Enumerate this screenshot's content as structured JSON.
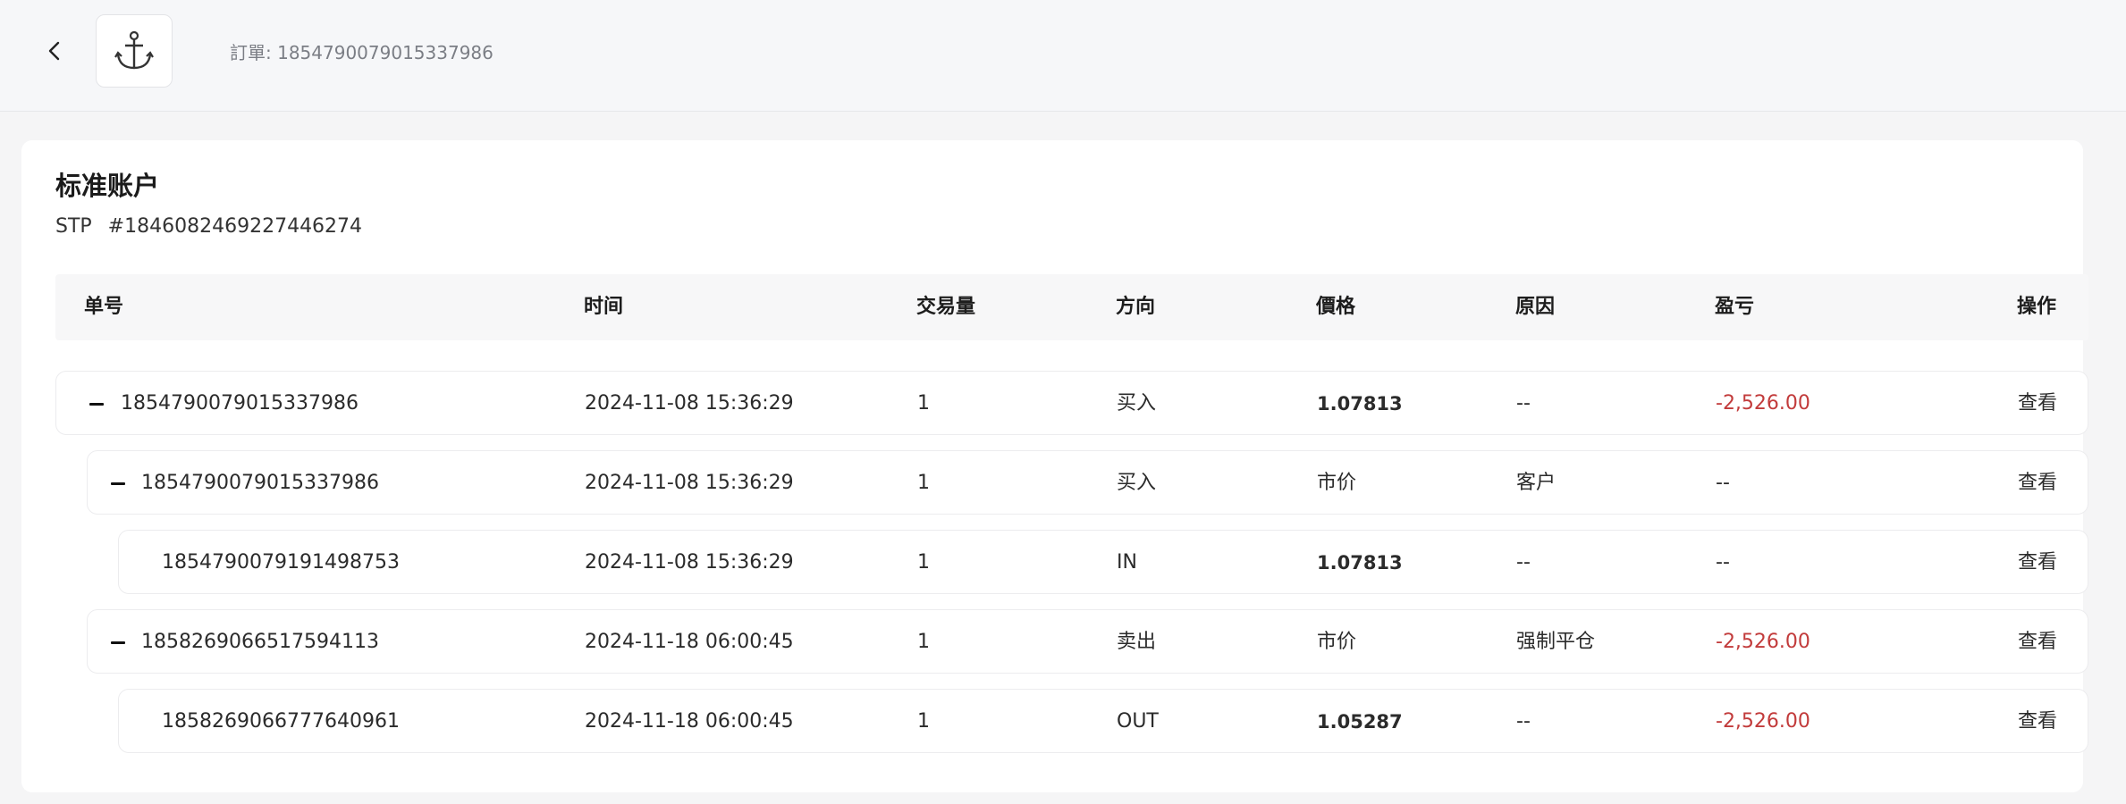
{
  "header": {
    "order_label": "訂單: 1854790079015337986"
  },
  "account": {
    "title": "标准账户",
    "type": "STP",
    "number": "#1846082469227446274"
  },
  "table": {
    "columns": [
      "单号",
      "时间",
      "交易量",
      "方向",
      "價格",
      "原因",
      "盈亏",
      "操作"
    ],
    "rows": [
      {
        "id": "1854790079015337986",
        "time": "2024-11-08 15:36:29",
        "volume": "1",
        "direction": "买入",
        "price": "1.07813",
        "reason": "--",
        "pnl": "-2,526.00",
        "action": "查看"
      },
      {
        "id": "1854790079015337986",
        "time": "2024-11-08 15:36:29",
        "volume": "1",
        "direction": "买入",
        "price": "市价",
        "reason": "客户",
        "pnl": "--",
        "action": "查看"
      },
      {
        "id": "1854790079191498753",
        "time": "2024-11-08 15:36:29",
        "volume": "1",
        "direction": "IN",
        "price": "1.07813",
        "reason": "--",
        "pnl": "--",
        "action": "查看"
      },
      {
        "id": "1858269066517594113",
        "time": "2024-11-18 06:00:45",
        "volume": "1",
        "direction": "卖出",
        "price": "市价",
        "reason": "强制平仓",
        "pnl": "-2,526.00",
        "action": "查看"
      },
      {
        "id": "1858269066777640961",
        "time": "2024-11-18 06:00:45",
        "volume": "1",
        "direction": "OUT",
        "price": "1.05287",
        "reason": "--",
        "pnl": "-2,526.00",
        "action": "查看"
      }
    ]
  },
  "icons": {
    "back": "chevron-left-icon",
    "logo": "anchor-icon",
    "collapse": "minus-icon"
  },
  "colors": {
    "negative": "#c23b3b"
  }
}
